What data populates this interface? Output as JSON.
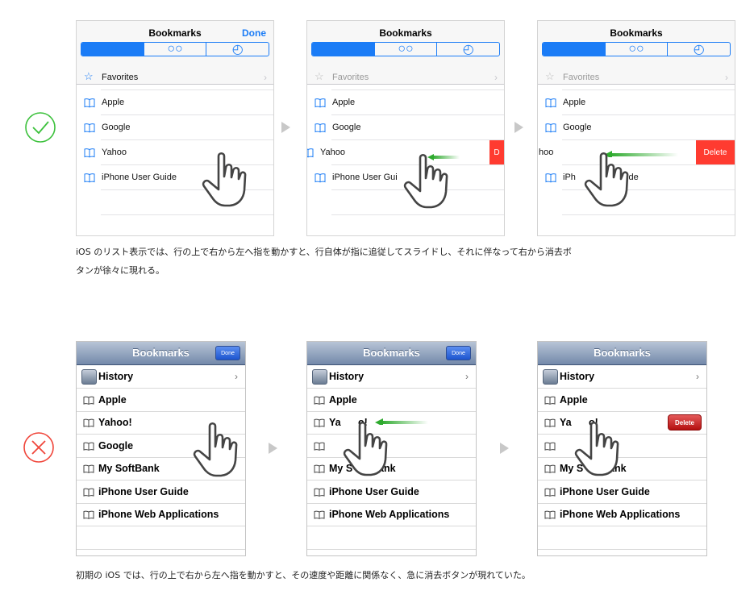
{
  "flat_ui": {
    "title": "Bookmarks",
    "done": "Done",
    "favorites": "Favorites",
    "items": [
      "Apple",
      "Google",
      "Yahoo",
      "iPhone User Guide"
    ],
    "partial_yahoo_2": "Yahoo",
    "partial_yahoo_3": "hoo",
    "partial_guide_2": "iPhone User Gui",
    "partial_guide_3a": "iPh",
    "partial_guide_3b": "uide",
    "delete_partial": "D",
    "delete": "Delete",
    "accent": "#1b7cf6",
    "delete_color": "#ff3b30"
  },
  "old_ui": {
    "title": "Bookmarks",
    "done": "Done",
    "history": "History",
    "items": [
      "Apple",
      "Yahoo!",
      "Google",
      "My SoftBank",
      "iPhone User Guide",
      "iPhone Web Applications"
    ],
    "partial_yahoo_a": "Ya",
    "partial_yahoo_b": "o!",
    "partial_softbank": "My S",
    "partial_softbank_b": "ank",
    "delete": "Delete"
  },
  "captions": {
    "good_line1": "iOS のリスト表示では、行の上で右から左へ指を動かすと、行自体が指に追従してスライドし、それに伴なって右から消去ボ",
    "good_line2": "タンが徐々に現れる。",
    "bad_line1": "初期の iOS では、行の上で右から左へ指を動かすと、その速度や距離に関係なく、急に消去ボタンが現れていた。"
  },
  "markers": {
    "good_color": "#3cc13c",
    "bad_color": "#f0453a",
    "good_icon": "check-circle-icon",
    "bad_icon": "cross-circle-icon"
  }
}
